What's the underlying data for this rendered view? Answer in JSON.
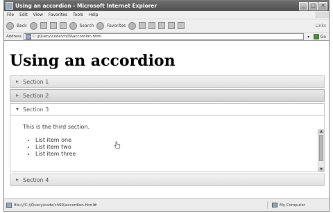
{
  "window": {
    "title": "Using an accordion - Microsoft Internet Explorer",
    "controls": {
      "minimize": "_",
      "maximize": "□",
      "close": "×"
    }
  },
  "menu": [
    "File",
    "Edit",
    "View",
    "Favorites",
    "Tools",
    "Help"
  ],
  "toolbar": {
    "back": "Back",
    "search": "Search",
    "favorites": "Favorites",
    "links": "Links"
  },
  "address": {
    "label": "Address",
    "value": "C:\\jQuery\\code\\ch09\\accordion.html",
    "go": "Go"
  },
  "page": {
    "heading": "Using an accordion",
    "sections": [
      {
        "label": "Section 1",
        "state": "collapsed"
      },
      {
        "label": "Section 2",
        "state": "hover"
      },
      {
        "label": "Section 3",
        "state": "expanded"
      },
      {
        "label": "Section 4",
        "state": "collapsed"
      }
    ],
    "panel": {
      "text": "This is the third section.",
      "items": [
        "List item one",
        "List item two",
        "List item three"
      ]
    }
  },
  "status": {
    "url": "file:///C:/jQuery/code/ch09/accordion.html#",
    "zone": "My Computer"
  }
}
